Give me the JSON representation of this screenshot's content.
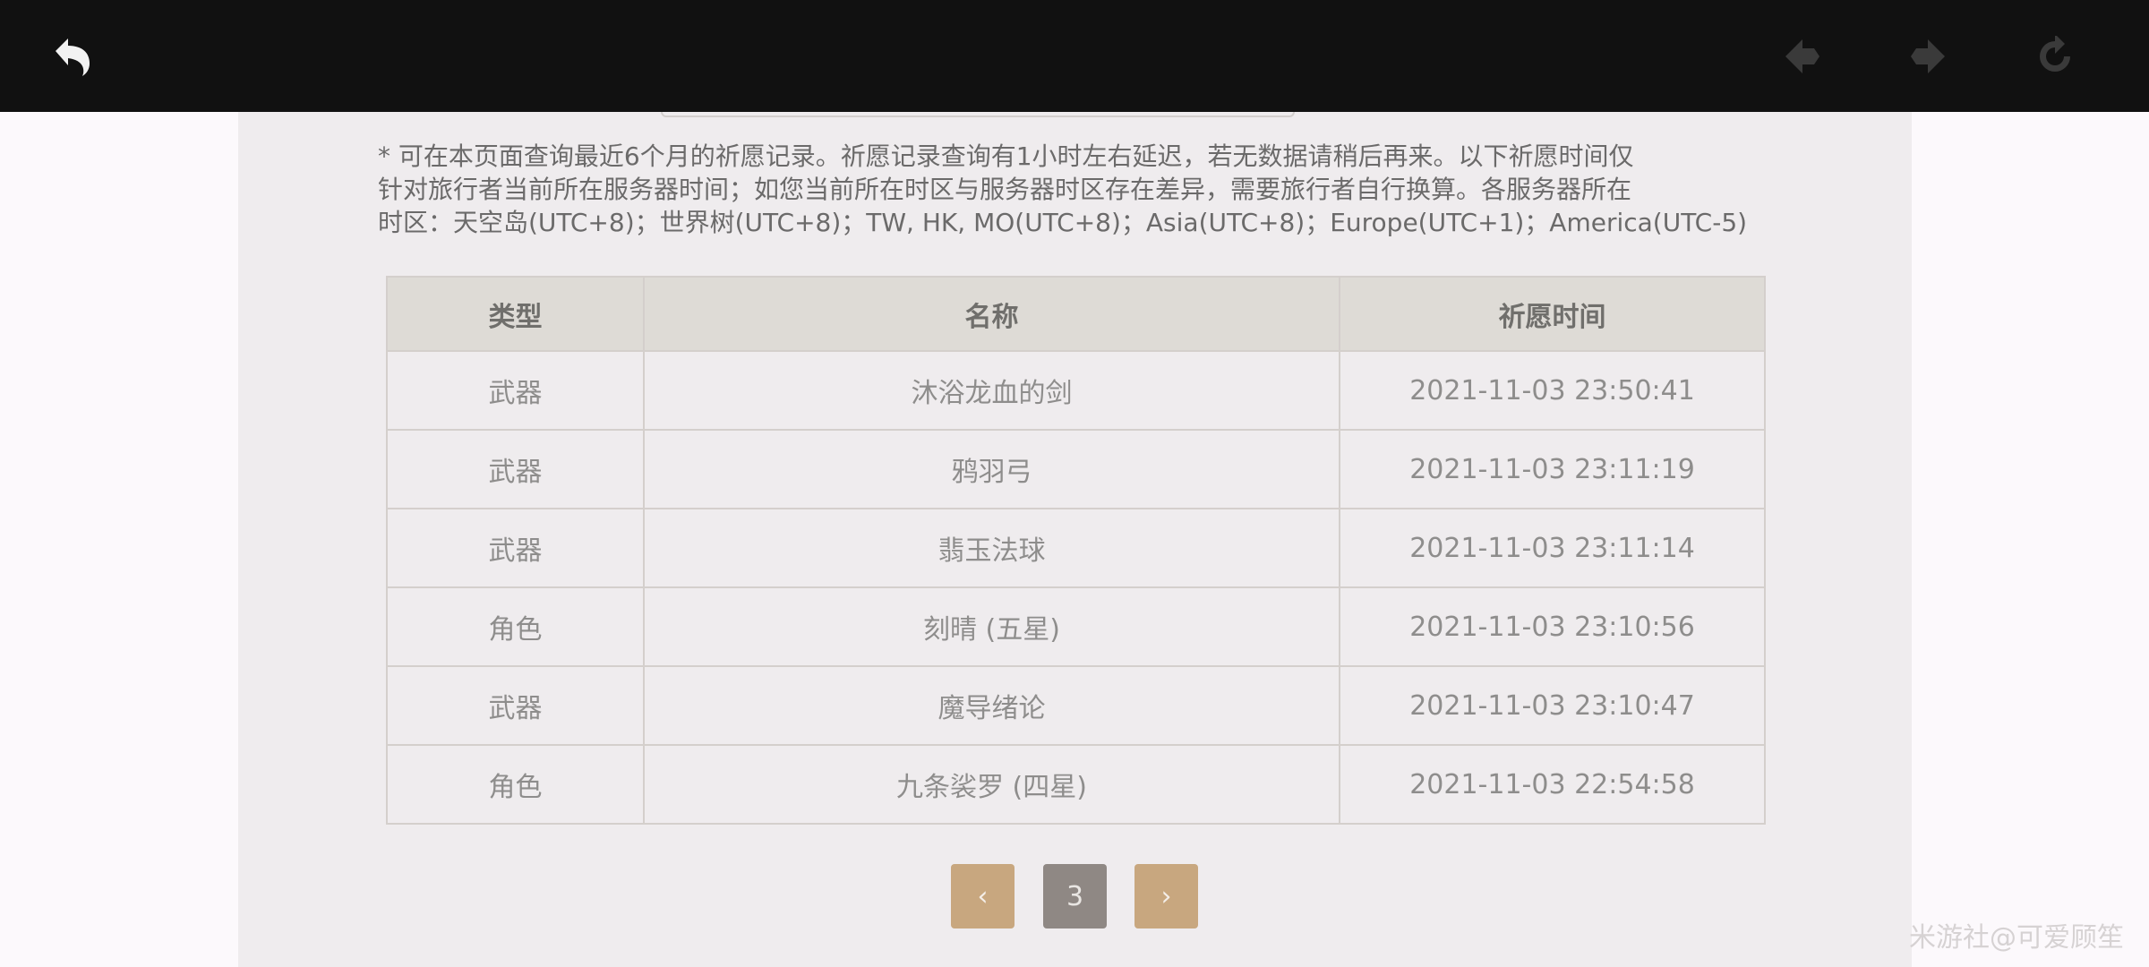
{
  "toolbar": {
    "back_icon": "back-arrow-icon",
    "prev_icon": "diamond-left-icon",
    "next_icon": "diamond-right-icon",
    "refresh_icon": "refresh-icon"
  },
  "notice": {
    "line1": "* 可在本页面查询最近6个月的祈愿记录。祈愿记录查询有1小时左右延迟，若无数据请稍后再来。以下祈愿时间仅",
    "line2": "针对旅行者当前所在服务器时间；如您当前所在时区与服务器时区存在差异，需要旅行者自行换算。各服务器所在",
    "line3": "时区：天空岛(UTC+8)；世界树(UTC+8)；TW, HK, MO(UTC+8)；Asia(UTC+8)；Europe(UTC+1)；America(UTC-5)"
  },
  "table": {
    "headers": [
      "类型",
      "名称",
      "祈愿时间"
    ],
    "rows": [
      {
        "type": "武器",
        "name": "沐浴龙血的剑",
        "time": "2021-11-03 23:50:41"
      },
      {
        "type": "武器",
        "name": "鸦羽弓",
        "time": "2021-11-03 23:11:19"
      },
      {
        "type": "武器",
        "name": "翡玉法球",
        "time": "2021-11-03 23:11:14"
      },
      {
        "type": "角色",
        "name": "刻晴 (五星)",
        "time": "2021-11-03 23:10:56"
      },
      {
        "type": "武器",
        "name": "魔导绪论",
        "time": "2021-11-03 23:10:47"
      },
      {
        "type": "角色",
        "name": "九条裟罗 (四星)",
        "time": "2021-11-03 22:54:58"
      }
    ]
  },
  "pagination": {
    "prev_label": "‹",
    "current_page": "3",
    "next_label": "›"
  },
  "watermark": "米游社@可爱顾笙",
  "colors": {
    "five_star": "#b9682f",
    "four_star": "#9f5ccb",
    "pager_arrow": "#c8a77f",
    "pager_current": "#8f8884"
  }
}
